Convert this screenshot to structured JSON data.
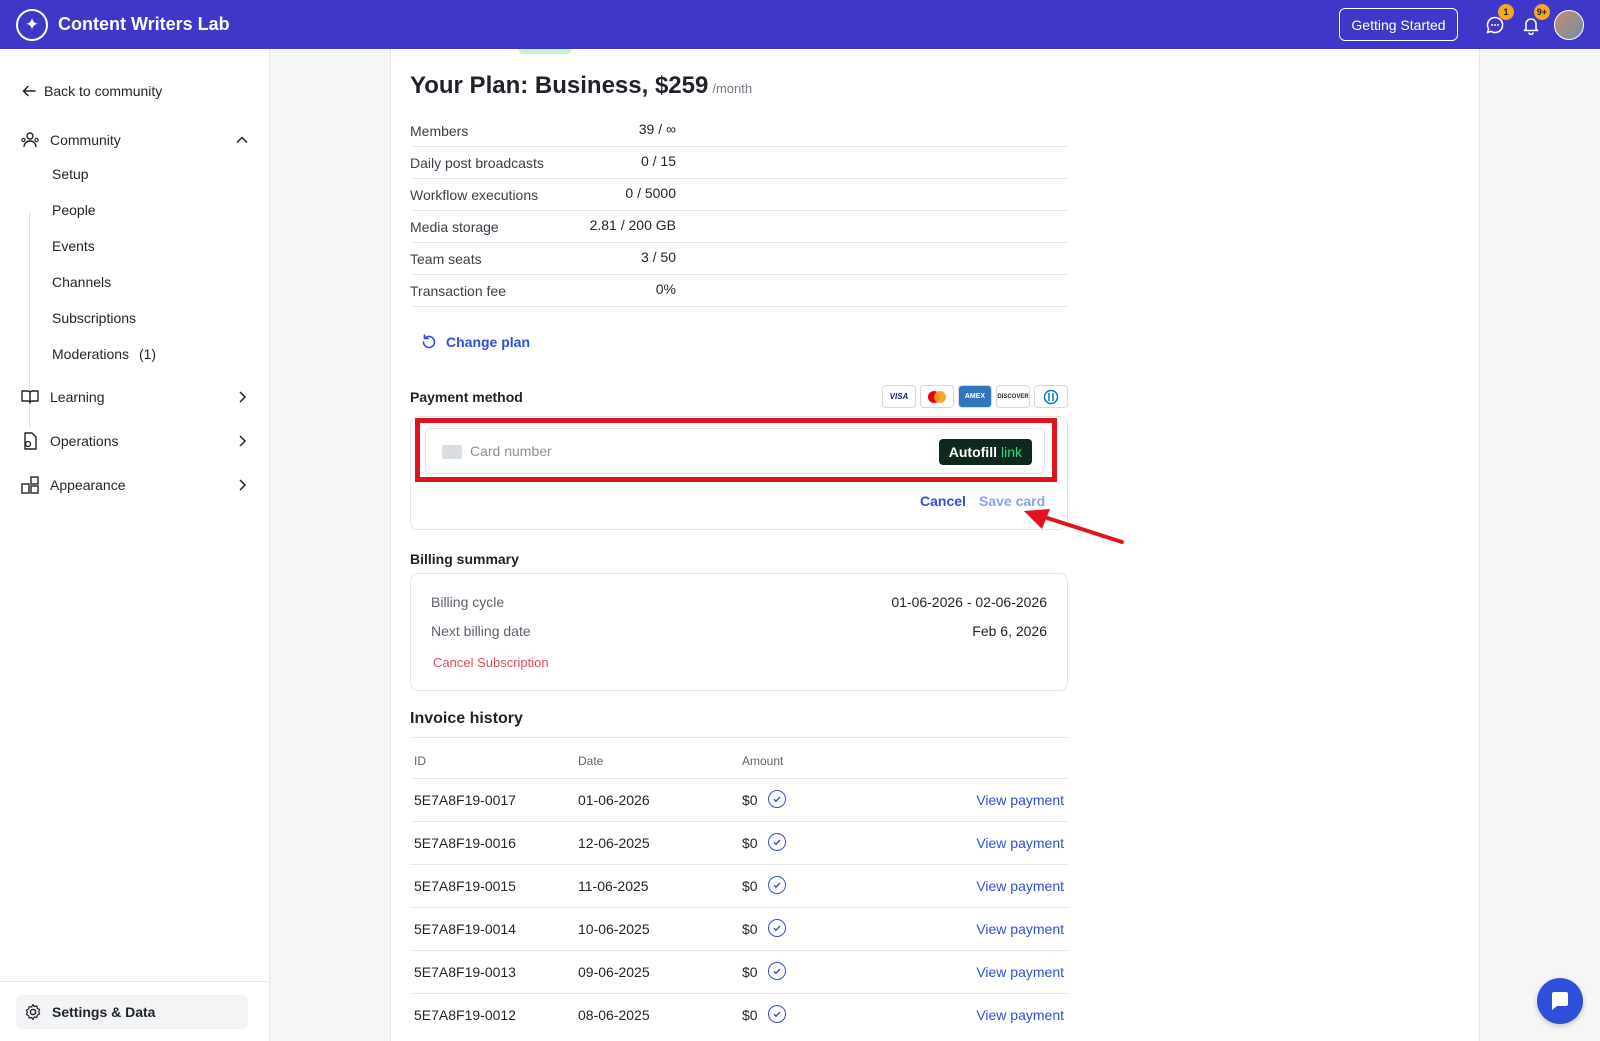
{
  "app": {
    "title": "Content Writers Lab"
  },
  "topbar": {
    "getting_started_label": "Getting Started",
    "messages_badge": "1",
    "notifications_badge": "9+",
    "accent_color": "#3f37c9"
  },
  "sidebar": {
    "back_label": "Back to community",
    "community": {
      "label": "Community",
      "items": [
        {
          "label": "Setup"
        },
        {
          "label": "People"
        },
        {
          "label": "Events"
        },
        {
          "label": "Channels"
        },
        {
          "label": "Subscriptions"
        },
        {
          "label": "Moderations",
          "count": "(1)"
        }
      ]
    },
    "learning_label": "Learning",
    "operations_label": "Operations",
    "appearance_label": "Appearance",
    "settings_label": "Settings & Data"
  },
  "plan": {
    "title": "Your Plan: Business, $259",
    "period": "/month",
    "usage": [
      {
        "label": "Members",
        "value": "39 / ∞"
      },
      {
        "label": "Daily post broadcasts",
        "value": "0 / 15"
      },
      {
        "label": "Workflow executions",
        "value": "0 / 5000"
      },
      {
        "label": "Media storage",
        "value": "2.81 / 200 GB"
      },
      {
        "label": "Team seats",
        "value": "3 / 50"
      },
      {
        "label": "Transaction fee",
        "value": "0%"
      }
    ],
    "change_plan_label": "Change plan"
  },
  "payment": {
    "section_label": "Payment method",
    "card_brands": [
      "VISA",
      "Mastercard",
      "AMEX",
      "DISCOVER",
      "Diners"
    ],
    "card_number_placeholder": "Card number",
    "autofill_label": "Autofill",
    "autofill_link_word": "link",
    "cancel_label": "Cancel",
    "save_card_label": "Save card"
  },
  "billing": {
    "section_label": "Billing summary",
    "cycle_label": "Billing cycle",
    "cycle_value": "01-06-2026 - 02-06-2026",
    "next_label": "Next billing date",
    "next_value": "Feb 6, 2026",
    "cancel_subscription_label": "Cancel Subscription"
  },
  "invoices": {
    "title": "Invoice history",
    "columns": {
      "id": "ID",
      "date": "Date",
      "amount": "Amount"
    },
    "rows": [
      {
        "id": "5E7A8F19-0017",
        "date": "01-06-2026",
        "amount": "$0",
        "action": "View payment"
      },
      {
        "id": "5E7A8F19-0016",
        "date": "12-06-2025",
        "amount": "$0",
        "action": "View payment"
      },
      {
        "id": "5E7A8F19-0015",
        "date": "11-06-2025",
        "amount": "$0",
        "action": "View payment"
      },
      {
        "id": "5E7A8F19-0014",
        "date": "10-06-2025",
        "amount": "$0",
        "action": "View payment"
      },
      {
        "id": "5E7A8F19-0013",
        "date": "09-06-2025",
        "amount": "$0",
        "action": "View payment"
      },
      {
        "id": "5E7A8F19-0012",
        "date": "08-06-2025",
        "amount": "$0",
        "action": "View payment"
      }
    ]
  }
}
